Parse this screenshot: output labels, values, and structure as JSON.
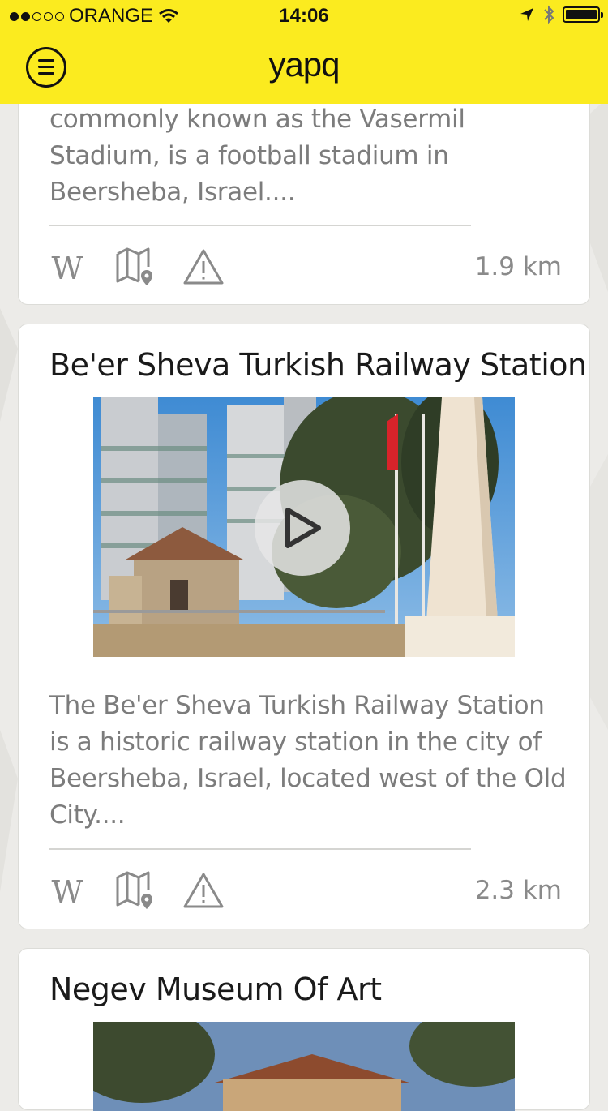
{
  "status_bar": {
    "carrier": "ORANGE",
    "time": "14:06",
    "signal_bars_filled": 2,
    "signal_bars_total": 5
  },
  "nav": {
    "logo": "yapq",
    "menu_icon": "menu-icon"
  },
  "cards": [
    {
      "description": "commonly known as the Vasermil Stadium, is a football stadium in Beersheba, Israel....",
      "distance": "1.9 km",
      "actions": [
        "wikipedia-icon",
        "map-pin-icon",
        "warning-icon"
      ]
    },
    {
      "title": "Be'er Sheva Turkish Railway Station",
      "description": "The Be'er Sheva Turkish Railway Station is a historic railway station in the city of Beersheba, Israel, located west of the Old City....",
      "distance": "2.3 km",
      "actions": [
        "wikipedia-icon",
        "map-pin-icon",
        "warning-icon"
      ],
      "media": "video"
    },
    {
      "title": "Negev Museum Of Art"
    }
  ],
  "wikipedia_glyph": "W",
  "colors": {
    "accent": "#fbeb1f",
    "text_primary": "#1a1a1a",
    "text_secondary": "#7c7c7c",
    "icon": "#8a8a8a"
  }
}
